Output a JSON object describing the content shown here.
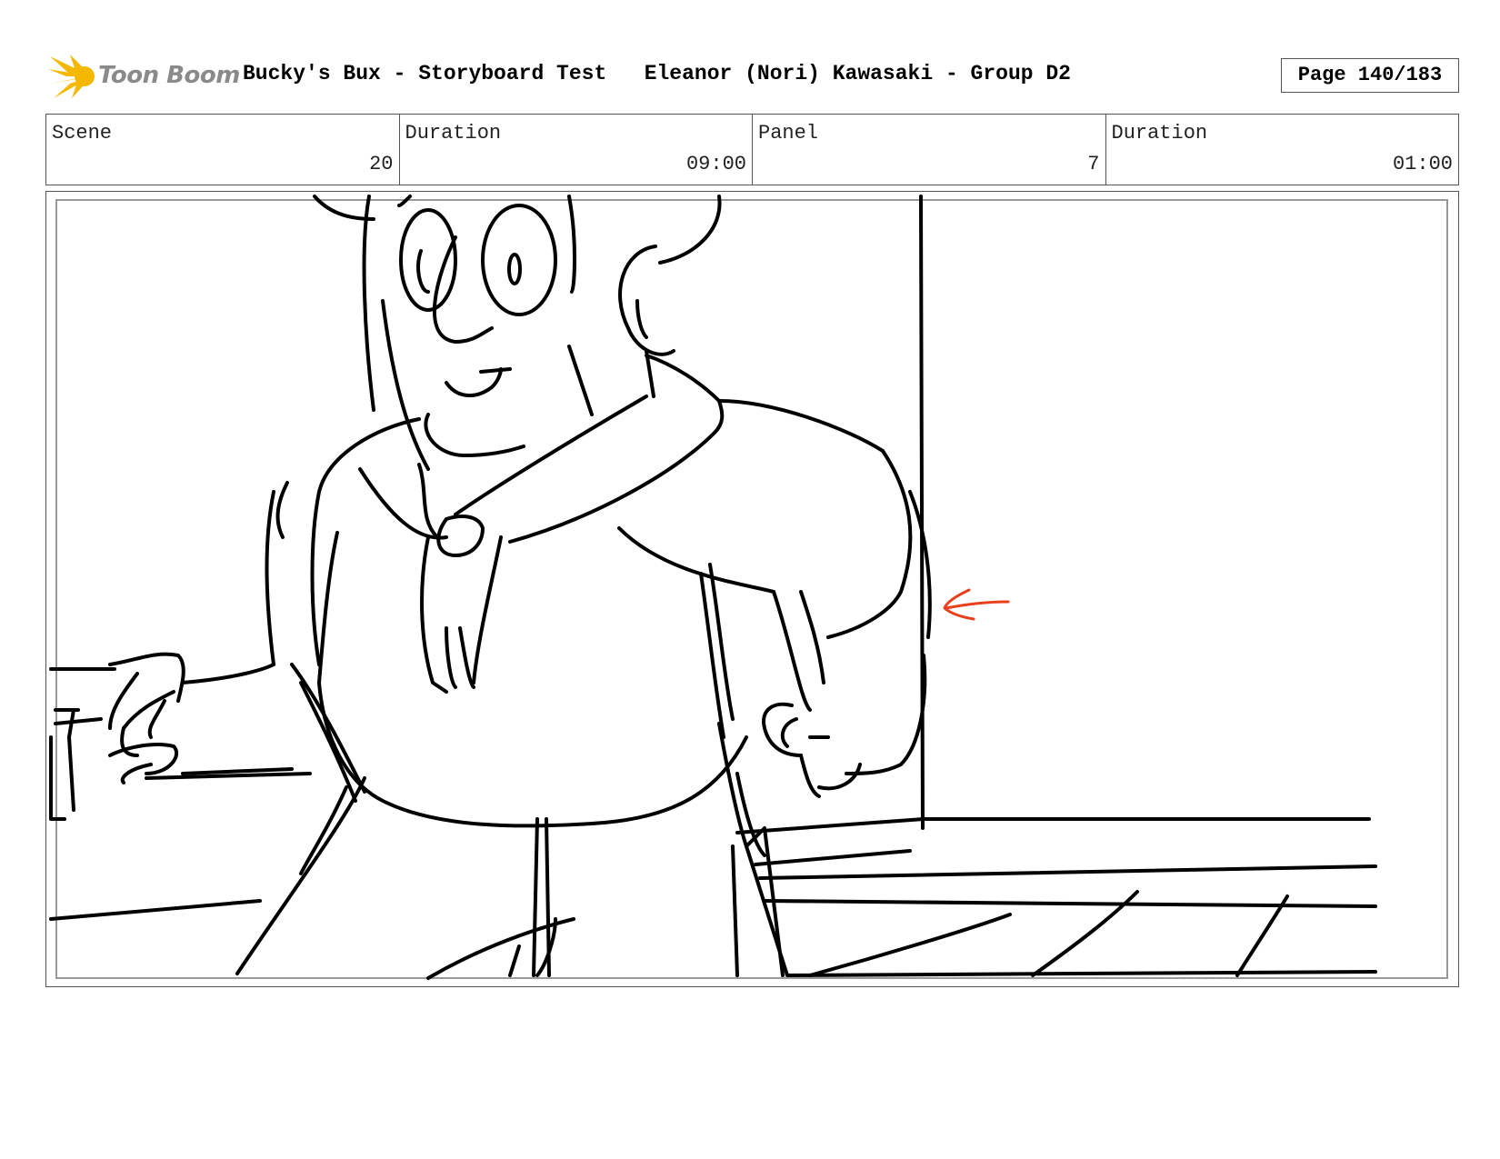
{
  "header": {
    "logo_text": "Toon Boom",
    "project_title": "Bucky's Bux - Storyboard Test",
    "artist": "Eleanor (Nori) Kawasaki - Group D2",
    "page_label": "Page 140/183"
  },
  "info": {
    "scene_label": "Scene",
    "scene_value": "20",
    "scene_duration_label": "Duration",
    "scene_duration_value": "09:00",
    "panel_label": "Panel",
    "panel_value": "7",
    "panel_duration_label": "Duration",
    "panel_duration_value": "01:00"
  },
  "colors": {
    "logo_accent": "#f5b800",
    "arrow_annotation": "#e8401c",
    "sketch_line": "#000000"
  },
  "icons": {
    "logo": "toon-boom-starburst-icon",
    "annotation": "left-arrow-icon"
  }
}
